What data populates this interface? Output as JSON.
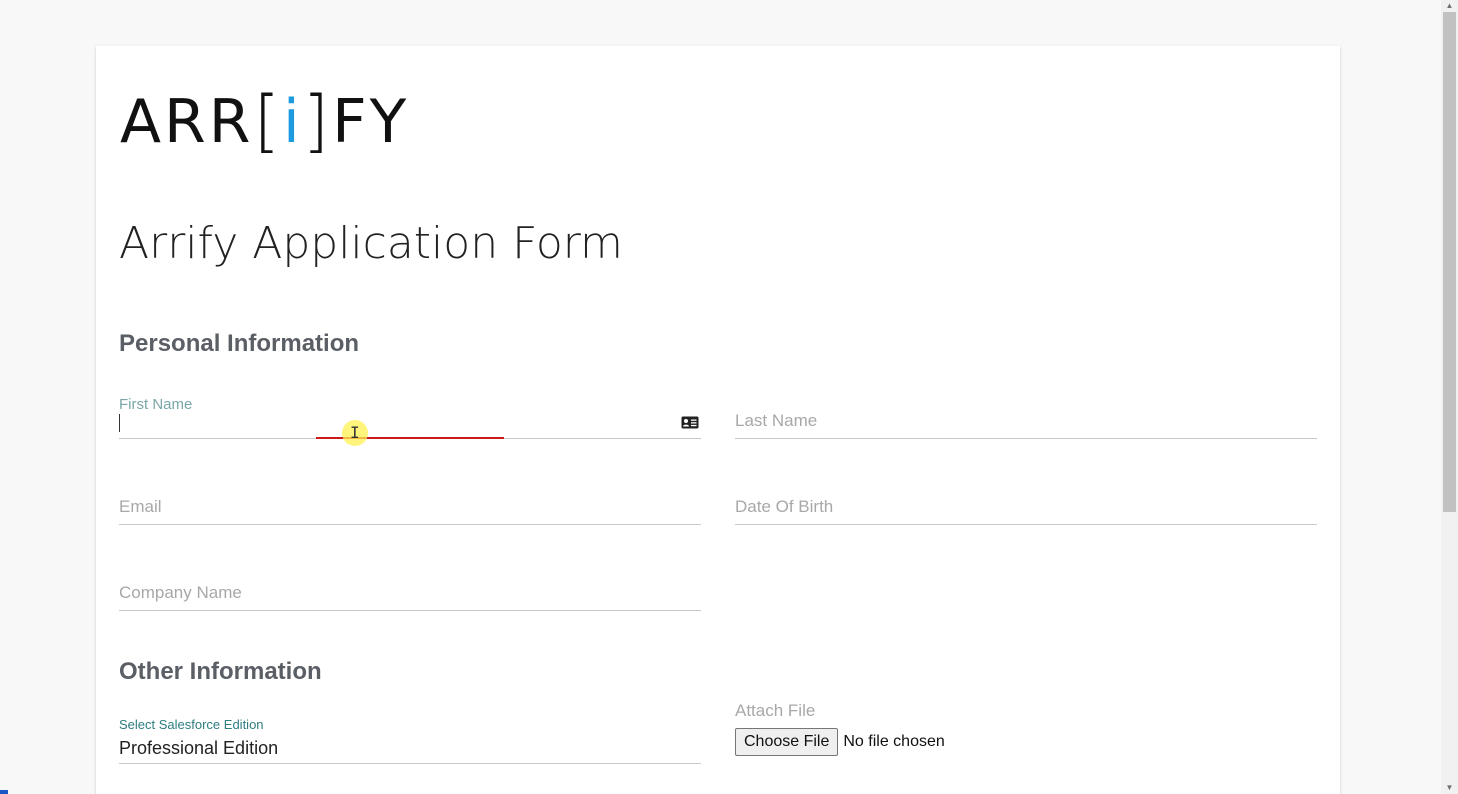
{
  "logo": {
    "part1": "ARR",
    "open_bracket": "[",
    "letter_i": "i",
    "close_bracket": "]",
    "part2": "FY",
    "accent_color": "#1d9be0"
  },
  "form": {
    "title": "Arrify Application Form"
  },
  "personal": {
    "section_title": "Personal Information",
    "first_name_label": "First Name",
    "last_name_placeholder": "Last Name",
    "email_placeholder": "Email",
    "dob_placeholder": "Date Of Birth",
    "company_placeholder": "Company Name",
    "contact_icon": "contact-card-icon"
  },
  "other": {
    "section_title": "Other Information",
    "edition_label": "Select Salesforce Edition",
    "edition_value": "Professional Edition",
    "attach_label": "Attach File",
    "choose_file_button": "Choose File",
    "no_file_text": "No file chosen"
  },
  "colors": {
    "focus_underline": "#cc1a1a",
    "float_label": "#7aa6a8",
    "edition_label": "#2e7d80"
  }
}
